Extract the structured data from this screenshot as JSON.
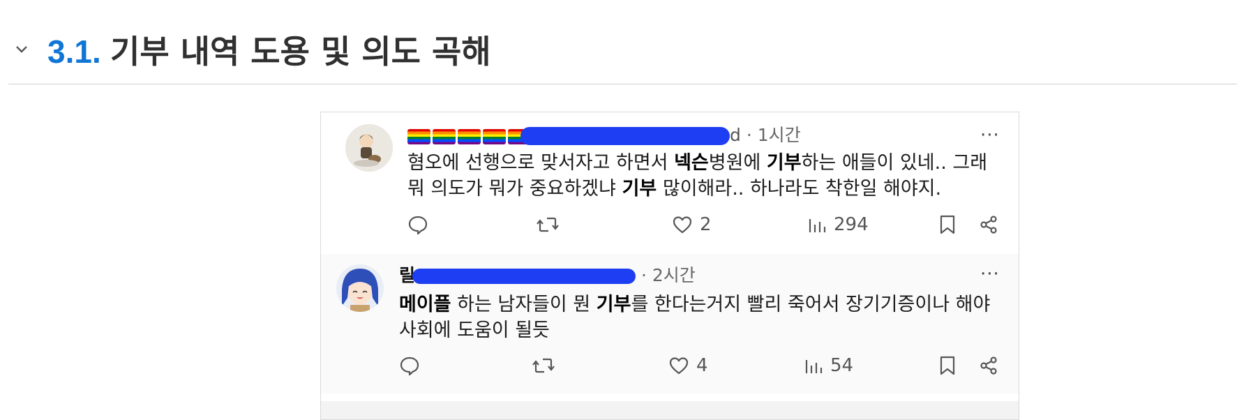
{
  "section": {
    "number": "3.1.",
    "title": "기부 내역 도용 및 의도 곡해"
  },
  "posts": [
    {
      "author_suffix": "d",
      "time": "· 1시간",
      "more": "···",
      "body": [
        {
          "t": "혐오에 선행으로 맞서자고 하면서 ",
          "b": false
        },
        {
          "t": "넥슨",
          "b": true
        },
        {
          "t": "병원에 ",
          "b": false
        },
        {
          "t": "기부",
          "b": true
        },
        {
          "t": "하는 애들이 있네.. 그래 뭐 의도가 뭐가 중요하겠냐 ",
          "b": false
        },
        {
          "t": "기부",
          "b": true
        },
        {
          "t": " 많이해라.. 하나라도 착한일 해야지.",
          "b": false
        }
      ],
      "replies": "",
      "likes": "2",
      "views": "294"
    },
    {
      "author_prefix": "릴",
      "time": "· 2시간",
      "more": "···",
      "body": [
        {
          "t": "메이플",
          "b": true
        },
        {
          "t": " 하는 남자들이 뭔 ",
          "b": false
        },
        {
          "t": "기부",
          "b": true
        },
        {
          "t": "를 한다는거지 빨리 죽어서 장기기증이나 해야 사회에 도움이 될듯",
          "b": false
        }
      ],
      "replies": "",
      "likes": "4",
      "views": "54"
    }
  ],
  "icons": [
    "chevron-down-icon",
    "reply-icon",
    "repost-icon",
    "heart-icon",
    "views-icon",
    "bookmark-icon",
    "share-icon",
    "more-icon"
  ],
  "colors": {
    "section_number": "#0f76d6",
    "redaction": "#1d3ef2"
  }
}
